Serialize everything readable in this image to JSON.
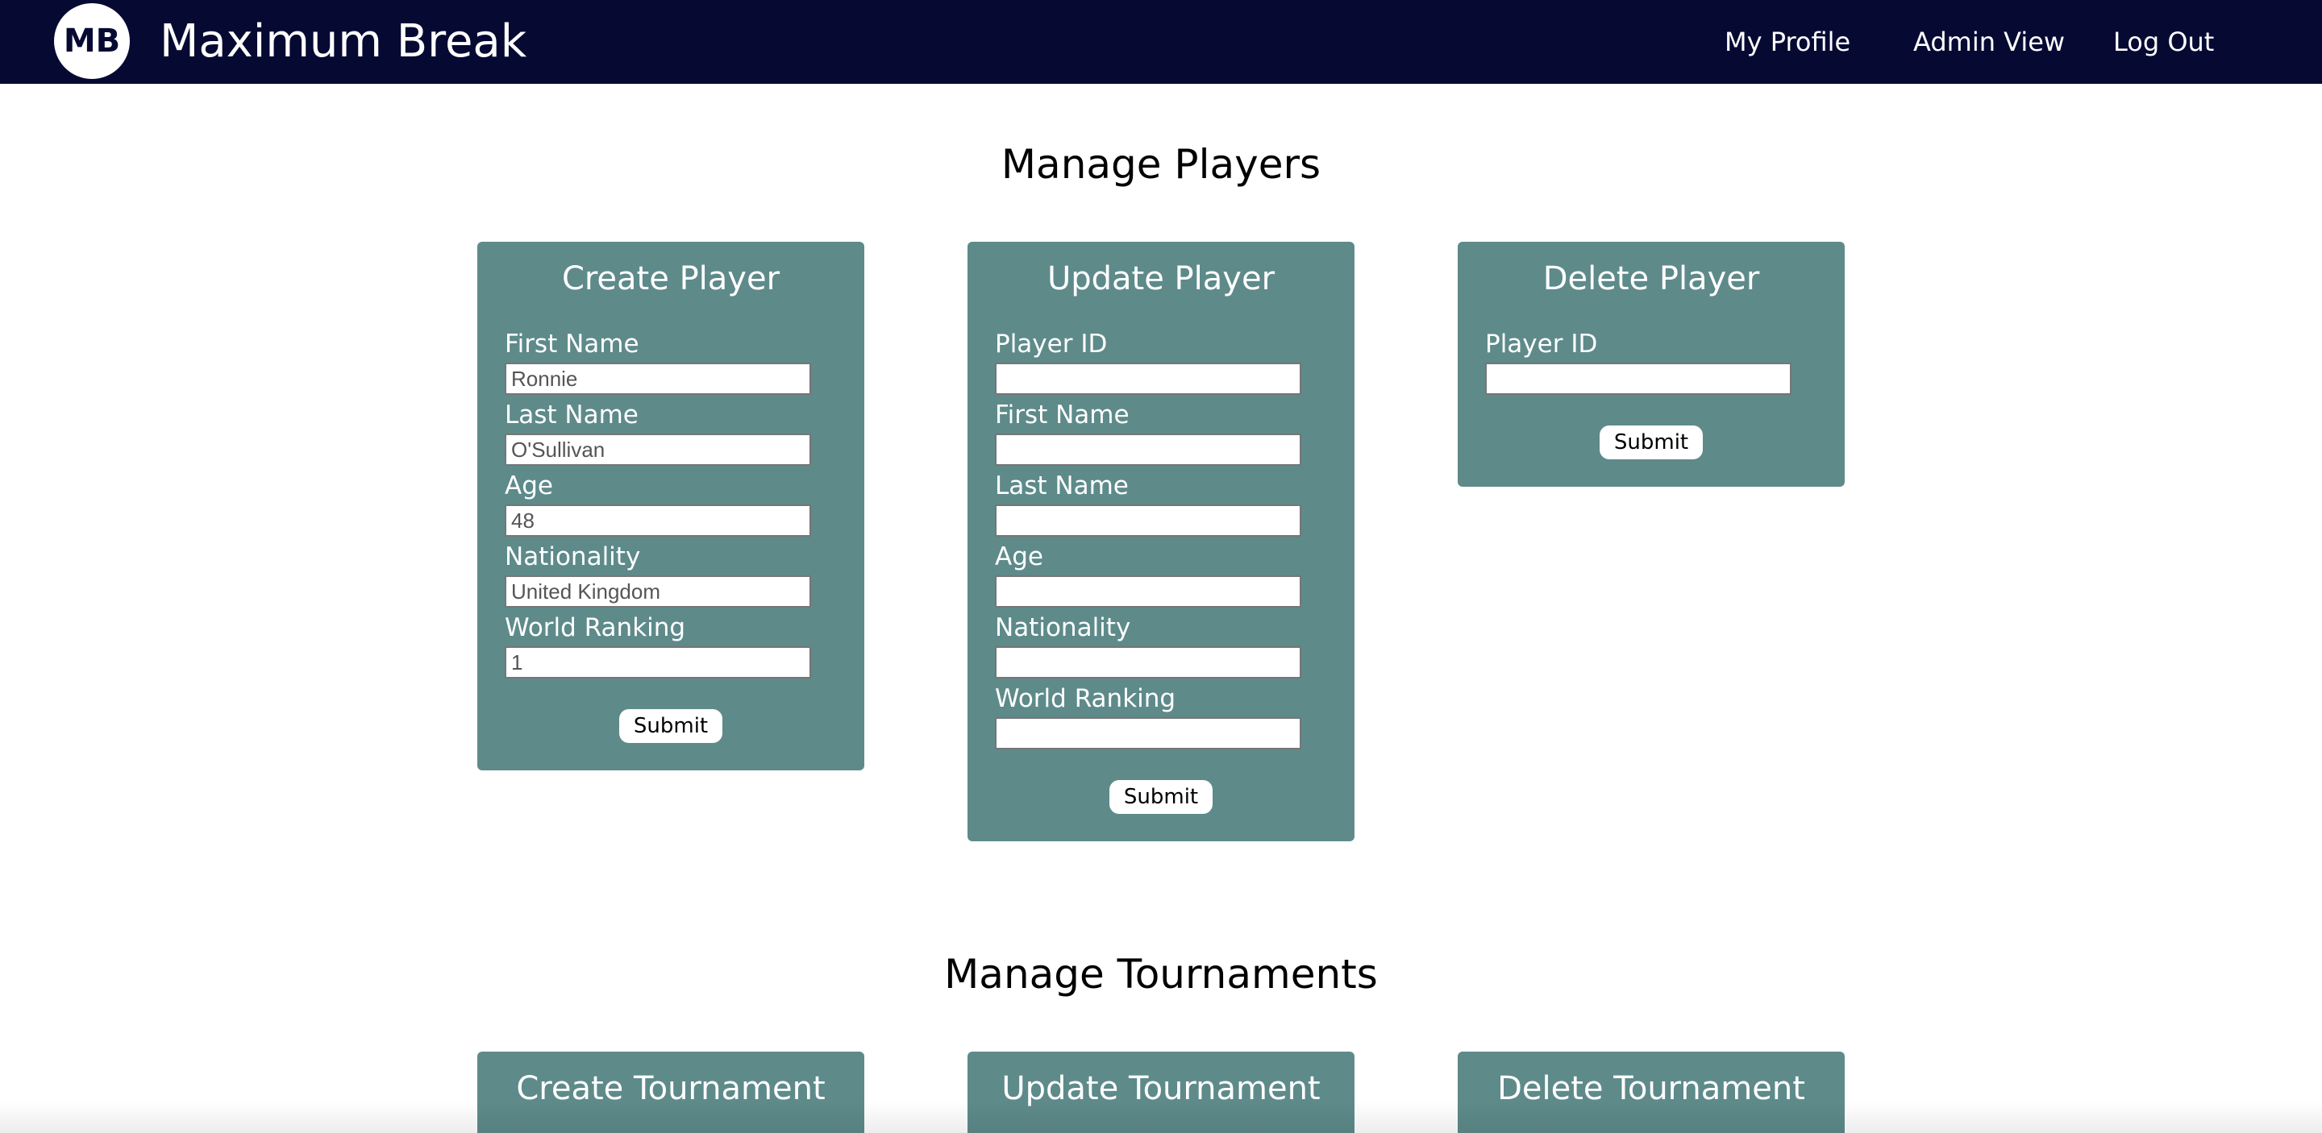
{
  "header": {
    "logo_text": "MB",
    "brand": "Maximum Break",
    "nav": [
      "My Profile",
      "Admin View",
      "Log Out"
    ]
  },
  "players_section": {
    "title": "Manage Players",
    "create": {
      "title": "Create Player",
      "fields": [
        {
          "label": "First Name",
          "value": "Ronnie"
        },
        {
          "label": "Last Name",
          "value": "O'Sullivan"
        },
        {
          "label": "Age",
          "value": "48"
        },
        {
          "label": "Nationality",
          "value": "United Kingdom"
        },
        {
          "label": "World Ranking",
          "value": "1"
        }
      ],
      "submit": "Submit"
    },
    "update": {
      "title": "Update Player",
      "fields": [
        {
          "label": "Player ID",
          "value": ""
        },
        {
          "label": "First Name",
          "value": ""
        },
        {
          "label": "Last Name",
          "value": ""
        },
        {
          "label": "Age",
          "value": ""
        },
        {
          "label": "Nationality",
          "value": ""
        },
        {
          "label": "World Ranking",
          "value": ""
        }
      ],
      "submit": "Submit"
    },
    "delete": {
      "title": "Delete Player",
      "fields": [
        {
          "label": "Player ID",
          "value": ""
        }
      ],
      "submit": "Submit"
    }
  },
  "tournaments_section": {
    "title": "Manage Tournaments",
    "cards": [
      "Create Tournament",
      "Update Tournament",
      "Delete Tournament"
    ]
  },
  "colors": {
    "navbar": "#060a33",
    "card": "#5e8a8a"
  }
}
